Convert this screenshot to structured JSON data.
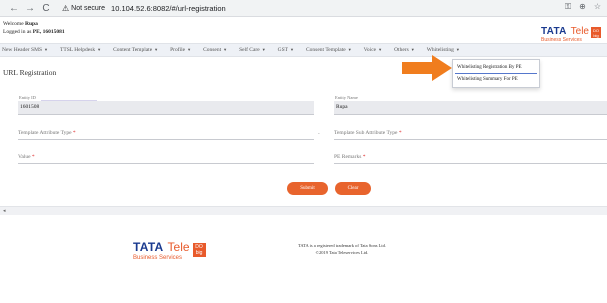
{
  "browser": {
    "back_icon": "←",
    "forward_icon": "→",
    "reload_icon": "C",
    "security_label": "Not secure",
    "url": "10.104.52.6:8082/#/url-registration",
    "key_icon": "⚿",
    "zoom_icon": "⊕",
    "star_icon": "☆"
  },
  "header": {
    "welcome_prefix": "Welcome ",
    "user_name": "Rupa",
    "logged_prefix": "Logged in as ",
    "logged_role": "PE, 16015081",
    "logo": {
      "tata": "TATA",
      "tele": "Tele",
      "business": "Business Services",
      "badge_top": "DO",
      "badge_bottom": "big"
    }
  },
  "menu": {
    "items": [
      {
        "label": "New Header SMS"
      },
      {
        "label": "TTSL Helpdesk"
      },
      {
        "label": "Content Template"
      },
      {
        "label": "Profile"
      },
      {
        "label": "Consent"
      },
      {
        "label": "Self Care"
      },
      {
        "label": "GST"
      },
      {
        "label": "Consent Template"
      },
      {
        "label": "Voice"
      },
      {
        "label": "Others"
      },
      {
        "label": "Whitelisting"
      }
    ],
    "caret": "▼"
  },
  "dropdown": {
    "items": [
      "Whitelisting Registration By PE",
      "Whitelisting Summary For PE"
    ]
  },
  "page": {
    "title": "URL Registration",
    "entity_id_label": "Entity ID",
    "entity_id_value": "1601508",
    "entity_name_label": "Entity Name",
    "entity_name_value": "Rupa",
    "template_attr_label": "Template Attribute Type",
    "template_sub_attr_label": "Template Sub Attribute Type",
    "value_label": "Value",
    "pe_remarks_label": "PE Remarks",
    "required_mark": "*",
    "dash": "-",
    "submit_label": "Submit",
    "clear_label": "Clear"
  },
  "scroll": {
    "arrow": "◂"
  },
  "footer": {
    "logo": {
      "tata": "TATA",
      "tele": "Tele",
      "business": "Business Services",
      "badge_top": "DO",
      "badge_bottom": "big"
    },
    "trademark": "TATA is a registered trademark of Tata Sons Ltd.",
    "copyright": "©2019 Tata Teleservices Ltd."
  },
  "colors": {
    "accent": "#e8642d",
    "brand_blue": "#1a3a8f",
    "arrow": "#f07d1e"
  }
}
